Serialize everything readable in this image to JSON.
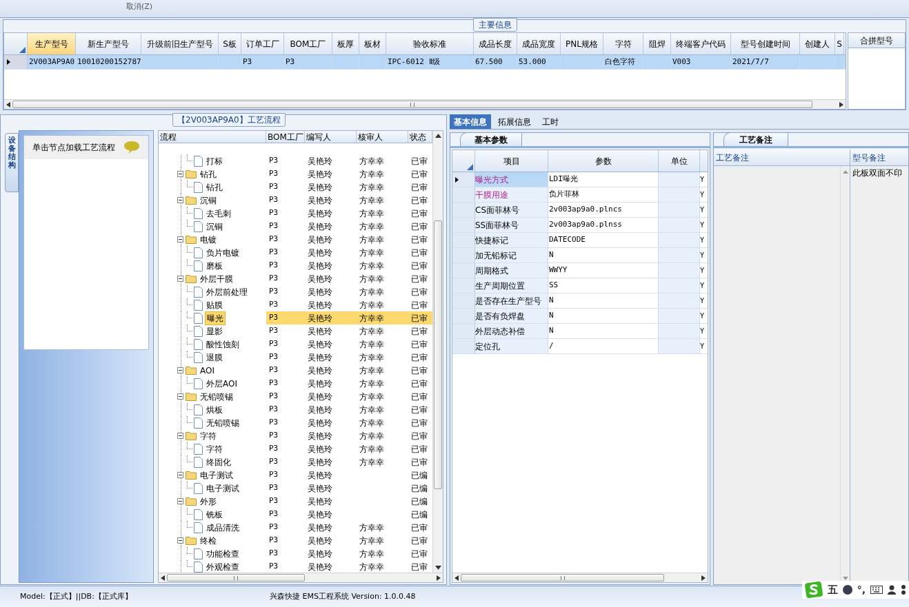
{
  "toolbar": {
    "button": "取消(Z)"
  },
  "main_info": {
    "title": "主要信息",
    "columns": [
      "生产型号",
      "新生产型号",
      "升级前旧生产型号",
      "S板",
      "订单工厂",
      "BOM工厂",
      "板厚",
      "板材",
      "验收标准",
      "成品长度",
      "成品宽度",
      "PNL规格",
      "字符",
      "阻焊",
      "终端客户代码",
      "型号创建时间",
      "创建人",
      "S"
    ],
    "rows": [
      {
        "selected": true,
        "cells": [
          "2V003AP9A0",
          "10010200152787",
          "",
          "",
          "P3",
          "P3",
          "",
          "",
          "IPC-6012 Ⅱ级",
          "67.500",
          "53.000",
          "",
          "白色字符",
          "",
          "V003",
          "2021/7/7",
          "",
          ""
        ]
      }
    ],
    "side_column": "合拼型号"
  },
  "process": {
    "title": "【2V003AP9A0】工艺流程",
    "side_tab": "设备结构",
    "hint": "单击节点加载工艺流程",
    "columns": [
      "流程",
      "BOM工厂",
      "编写人",
      "核审人",
      "状态"
    ],
    "tree": [
      {
        "children": [
          {
            "label": "打标",
            "bom": "P3",
            "writer": "吴艳玲",
            "reviewer": "方幸幸",
            "status": "已审",
            "selected": false
          }
        ]
      },
      {
        "label": "钻孔",
        "bom": "P3",
        "writer": "吴艳玲",
        "reviewer": "方幸幸",
        "status": "已审",
        "selected": false,
        "expanded": true,
        "children": [
          {
            "label": "钻孔",
            "bom": "P3",
            "writer": "吴艳玲",
            "reviewer": "方幸幸",
            "status": "已审",
            "selected": false
          }
        ]
      },
      {
        "label": "沉铜",
        "bom": "P3",
        "writer": "吴艳玲",
        "reviewer": "方幸幸",
        "status": "已审",
        "selected": false,
        "expanded": true,
        "children": [
          {
            "label": "去毛刺",
            "bom": "P3",
            "writer": "吴艳玲",
            "reviewer": "方幸幸",
            "status": "已审",
            "selected": false
          },
          {
            "label": "沉铜",
            "bom": "P3",
            "writer": "吴艳玲",
            "reviewer": "方幸幸",
            "status": "已审",
            "selected": false
          }
        ]
      },
      {
        "label": "电镀",
        "bom": "P3",
        "writer": "吴艳玲",
        "reviewer": "方幸幸",
        "status": "已审",
        "selected": false,
        "expanded": true,
        "children": [
          {
            "label": "负片电镀",
            "bom": "P3",
            "writer": "吴艳玲",
            "reviewer": "方幸幸",
            "status": "已审",
            "selected": false
          },
          {
            "label": "磨板",
            "bom": "P3",
            "writer": "吴艳玲",
            "reviewer": "方幸幸",
            "status": "已审",
            "selected": false
          }
        ]
      },
      {
        "label": "外层干膜",
        "bom": "P3",
        "writer": "吴艳玲",
        "reviewer": "方幸幸",
        "status": "已审",
        "selected": false,
        "expanded": true,
        "children": [
          {
            "label": "外层前处理",
            "bom": "P3",
            "writer": "吴艳玲",
            "reviewer": "方幸幸",
            "status": "已审",
            "selected": false
          },
          {
            "label": "贴膜",
            "bom": "P3",
            "writer": "吴艳玲",
            "reviewer": "方幸幸",
            "status": "已审",
            "selected": false
          },
          {
            "label": "曝光",
            "bom": "P3",
            "writer": "吴艳玲",
            "reviewer": "方幸幸",
            "status": "已审",
            "selected": true
          },
          {
            "label": "显影",
            "bom": "P3",
            "writer": "吴艳玲",
            "reviewer": "方幸幸",
            "status": "已审",
            "selected": false
          },
          {
            "label": "酸性蚀刻",
            "bom": "P3",
            "writer": "吴艳玲",
            "reviewer": "方幸幸",
            "status": "已审",
            "selected": false
          },
          {
            "label": "退膜",
            "bom": "P3",
            "writer": "吴艳玲",
            "reviewer": "方幸幸",
            "status": "已审",
            "selected": false
          }
        ]
      },
      {
        "label": "AOI",
        "bom": "P3",
        "writer": "吴艳玲",
        "reviewer": "方幸幸",
        "status": "已审",
        "selected": false,
        "expanded": true,
        "children": [
          {
            "label": "外层AOI",
            "bom": "P3",
            "writer": "吴艳玲",
            "reviewer": "方幸幸",
            "status": "已审",
            "selected": false
          }
        ]
      },
      {
        "label": "无铅喷锡",
        "bom": "P3",
        "writer": "吴艳玲",
        "reviewer": "方幸幸",
        "status": "已审",
        "selected": false,
        "expanded": true,
        "children": [
          {
            "label": "烘板",
            "bom": "P3",
            "writer": "吴艳玲",
            "reviewer": "方幸幸",
            "status": "已审",
            "selected": false
          },
          {
            "label": "无铅喷锡",
            "bom": "P3",
            "writer": "吴艳玲",
            "reviewer": "方幸幸",
            "status": "已审",
            "selected": false
          }
        ]
      },
      {
        "label": "字符",
        "bom": "P3",
        "writer": "吴艳玲",
        "reviewer": "方幸幸",
        "status": "已审",
        "selected": false,
        "expanded": true,
        "children": [
          {
            "label": "字符",
            "bom": "P3",
            "writer": "吴艳玲",
            "reviewer": "方幸幸",
            "status": "已审",
            "selected": false
          },
          {
            "label": "终固化",
            "bom": "P3",
            "writer": "吴艳玲",
            "reviewer": "方幸幸",
            "status": "已审",
            "selected": false
          }
        ]
      },
      {
        "label": "电子测试",
        "bom": "P3",
        "writer": "吴艳玲",
        "status": "已编",
        "selected": false,
        "expanded": true,
        "children": [
          {
            "label": "电子测试",
            "bom": "P3",
            "writer": "吴艳玲",
            "status": "已编",
            "selected": false
          }
        ]
      },
      {
        "label": "外形",
        "bom": "P3",
        "writer": "吴艳玲",
        "status": "已编",
        "selected": false,
        "expanded": true,
        "children": [
          {
            "label": "铣板",
            "bom": "P3",
            "writer": "吴艳玲",
            "status": "已编",
            "selected": false
          },
          {
            "label": "成品清洗",
            "bom": "P3",
            "writer": "吴艳玲",
            "reviewer": "方幸幸",
            "status": "已审",
            "selected": false
          }
        ]
      },
      {
        "label": "终检",
        "bom": "P3",
        "writer": "吴艳玲",
        "reviewer": "方幸幸",
        "status": "已审",
        "selected": false,
        "expanded": true,
        "children": [
          {
            "label": "功能检查",
            "bom": "P3",
            "writer": "吴艳玲",
            "reviewer": "方幸幸",
            "status": "已审",
            "selected": false
          },
          {
            "label": "外观检查",
            "bom": "P3",
            "writer": "吴艳玲",
            "reviewer": "方幸幸",
            "status": "已审",
            "selected": false
          }
        ]
      }
    ]
  },
  "detail_tabs": [
    {
      "label": "基本信息",
      "selected": true
    },
    {
      "label": "拓展信息",
      "selected": false
    },
    {
      "label": "工时",
      "selected": false
    }
  ],
  "params": {
    "title": "基本参数",
    "columns": [
      "项目",
      "参数",
      "单位"
    ],
    "rows": [
      {
        "item": "曝光方式",
        "value": "LDI曝光",
        "flag": "Y",
        "required": true,
        "selected": true
      },
      {
        "item": "干膜用途",
        "value": "负片菲林",
        "flag": "Y",
        "required": true,
        "selected": false
      },
      {
        "item": "CS面菲林号",
        "value": "2v003ap9a0.plncs",
        "flag": "Y",
        "required": false,
        "selected": false
      },
      {
        "item": "SS面菲林号",
        "value": "2v003ap9a0.plnss",
        "flag": "Y",
        "required": false,
        "selected": false
      },
      {
        "item": "快捷标记",
        "value": "DATECODE",
        "flag": "Y",
        "required": false,
        "selected": false
      },
      {
        "item": "加无铅标记",
        "value": "N",
        "flag": "Y",
        "required": false,
        "selected": false
      },
      {
        "item": "周期格式",
        "value": "WWYY",
        "flag": "Y",
        "required": false,
        "selected": false
      },
      {
        "item": "生产周期位置",
        "value": "SS",
        "flag": "Y",
        "required": false,
        "selected": false
      },
      {
        "item": "是否存在生产型号",
        "value": "N",
        "flag": "Y",
        "required": false,
        "selected": false
      },
      {
        "item": "是否有负焊盘",
        "value": "N",
        "flag": "Y",
        "required": false,
        "selected": false
      },
      {
        "item": "外层动态补偿",
        "value": "N",
        "flag": "Y",
        "required": false,
        "selected": false
      },
      {
        "item": "定位孔",
        "value": "/",
        "flag": "Y",
        "required": false,
        "selected": false
      }
    ]
  },
  "notes": {
    "title": "工艺备注",
    "columns": [
      "工艺备注",
      "型号备注"
    ],
    "model_note": "此板双面不印"
  },
  "status_bar": {
    "left": "Model:【正式】||DB:【正式库】",
    "right": "兴森快捷 EMS工程系统 Version: 1.0.0.48"
  },
  "ime": {
    "mode": "五",
    "punct": "°,"
  }
}
